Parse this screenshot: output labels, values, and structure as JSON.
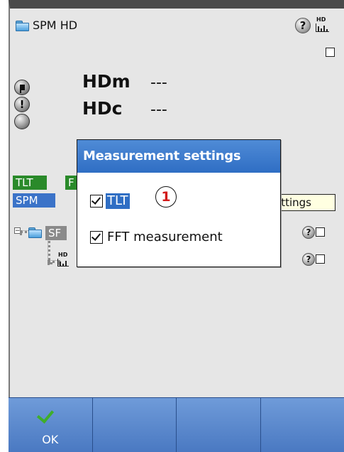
{
  "window": {
    "title": "SPM HD"
  },
  "header_icons": {
    "help": "?",
    "hd_badge": "HD",
    "checkbox": "unchecked"
  },
  "measurements": [
    {
      "label": "HDm",
      "value": "---"
    },
    {
      "label": "HDc",
      "value": "---"
    }
  ],
  "status_indicators": [
    "flag-icon",
    "!",
    "empty"
  ],
  "tags": {
    "tlt": "TLT",
    "f": "F",
    "spm": "SPM"
  },
  "tree": {
    "node_label": "SF",
    "child_badge": "HD"
  },
  "tooltip": {
    "text": "ettings"
  },
  "dialog": {
    "title": "Measurement settings",
    "options": [
      {
        "label": "TLT",
        "checked": true,
        "selected": true
      },
      {
        "label": "FFT measurement",
        "checked": true,
        "selected": false
      }
    ]
  },
  "callout": {
    "number": "1",
    "color": "#d21b1b"
  },
  "softkeys": [
    {
      "label": "OK",
      "icon": "checkmark-icon"
    },
    {
      "label": ""
    },
    {
      "label": ""
    },
    {
      "label": ""
    }
  ],
  "colors": {
    "softkey_bar": "#5a86cc",
    "dialog_title": "#2f6ec4",
    "tag_green": "#2a8a2a",
    "tag_blue": "#3b73c8"
  }
}
